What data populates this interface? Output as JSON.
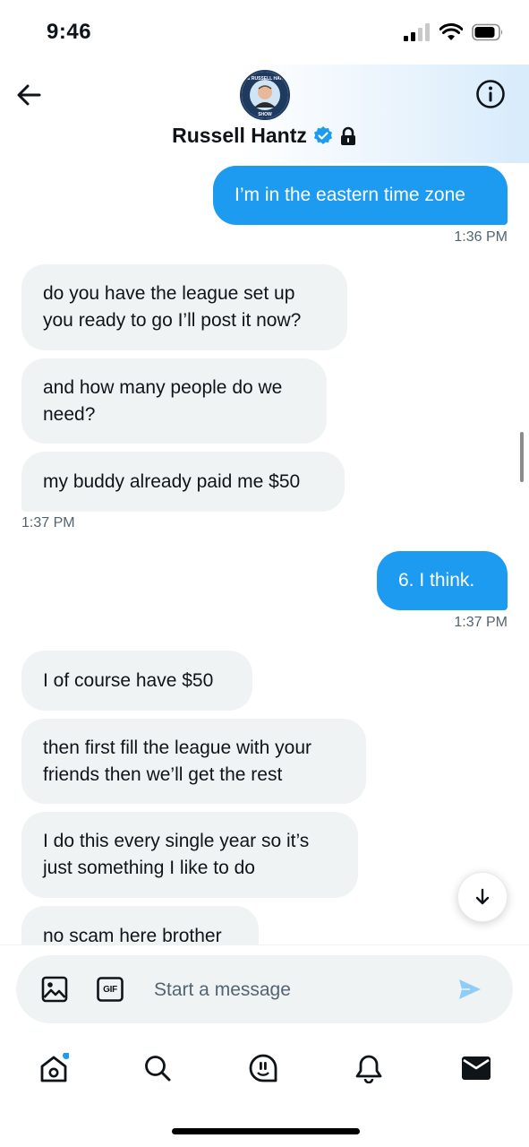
{
  "status_bar": {
    "time": "9:46"
  },
  "header": {
    "contact_name": "Russell Hantz",
    "avatar_ring_text": "THE RUSSELL HANTZ SHOW"
  },
  "messages": [
    {
      "id": "m1",
      "dir": "out",
      "lines": [
        "I’m in the eastern time zone"
      ]
    },
    {
      "id": "m2",
      "dir": "in",
      "lines": [
        "do you have the league set up",
        "you ready to go I’ll post it now?"
      ]
    },
    {
      "id": "m3",
      "dir": "in",
      "lines": [
        "and how many people do we",
        "need?"
      ]
    },
    {
      "id": "m4",
      "dir": "in",
      "lines": [
        "my buddy already paid me $50"
      ]
    },
    {
      "id": "m5",
      "dir": "out",
      "lines": [
        "6. I think."
      ]
    },
    {
      "id": "m6",
      "dir": "in",
      "lines": [
        "I of course have $50"
      ]
    },
    {
      "id": "m7",
      "dir": "in",
      "lines": [
        "then first fill the league with your",
        "friends then we’ll get the rest"
      ]
    },
    {
      "id": "m8",
      "dir": "in",
      "lines": [
        "I do this every single year so it’s",
        "just something I like to do"
      ]
    },
    {
      "id": "m9",
      "dir": "in",
      "lines": [
        "no scam here brother"
      ]
    }
  ],
  "timestamps": {
    "t1": "1:36 PM",
    "t2": "1:37 PM",
    "t3": "1:37 PM"
  },
  "composer": {
    "placeholder": "Start a message",
    "gif_label": "GIF"
  },
  "nav": {
    "items": [
      "home-icon",
      "search-icon",
      "spaces-icon",
      "notifications-icon",
      "messages-icon"
    ],
    "home_has_dot": true
  },
  "colors": {
    "accent": "#1d9bf0",
    "incoming_bubble": "#eff3f4",
    "verified": "#1d9bf0"
  }
}
